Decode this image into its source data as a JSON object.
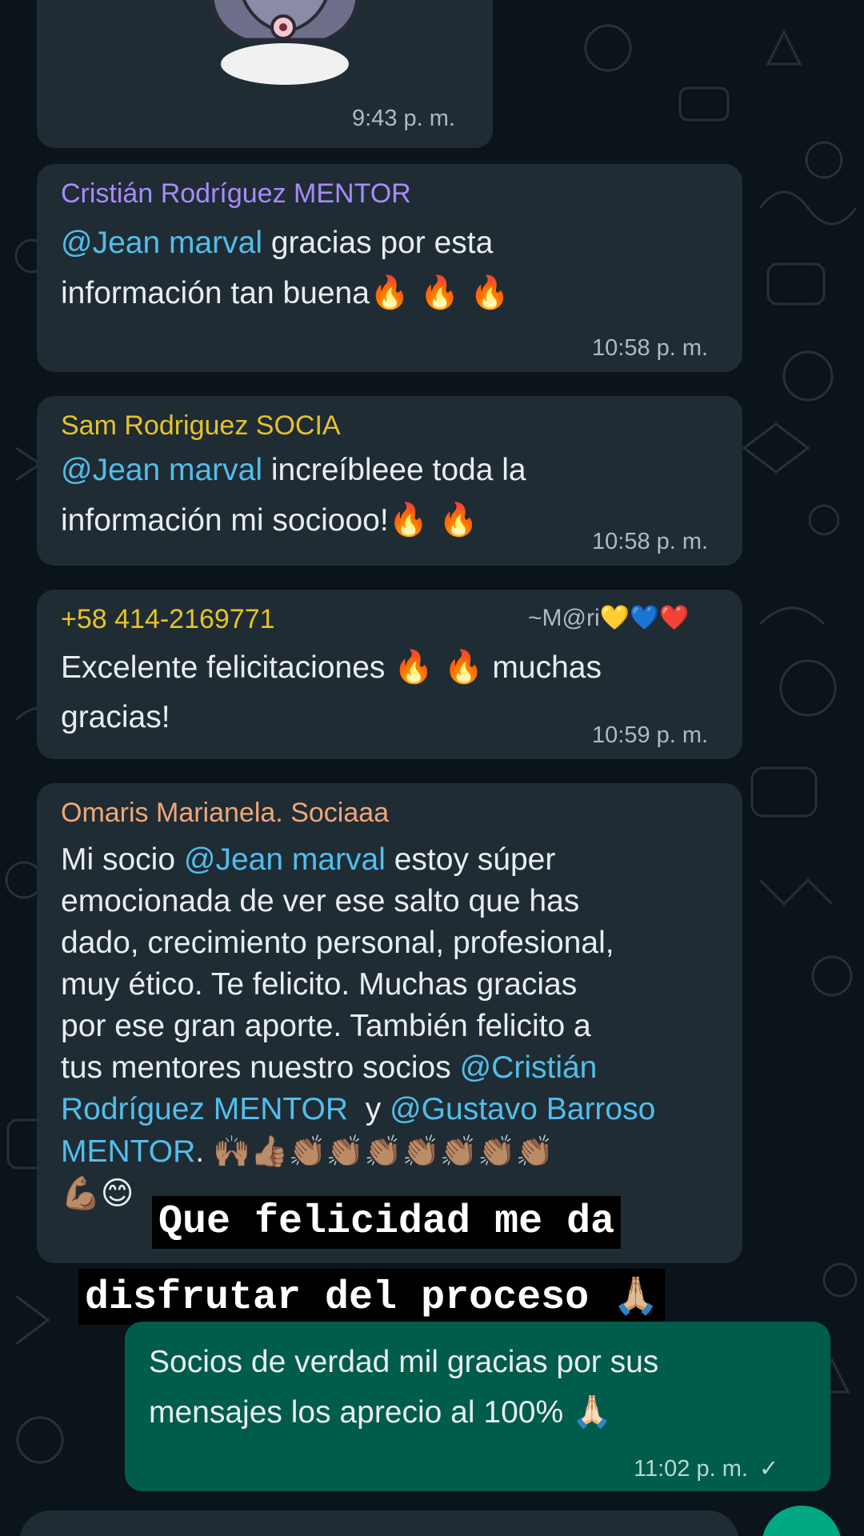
{
  "messages": [
    {
      "time": "9:43 p. m."
    },
    {
      "sender": "Cristián Rodríguez MENTOR",
      "sender_color": "#a78bfa",
      "mention": "@Jean marval",
      "line1_rest": " gracias por esta",
      "line2": "información tan buena",
      "emojis": "🔥 🔥 🔥",
      "time": "10:58 p. m."
    },
    {
      "sender": "Sam Rodriguez SOCIA",
      "sender_color": "#e6c229",
      "mention": "@Jean marval",
      "line1_rest": " increíbleee toda la",
      "line2": "información mi sociooo!",
      "emojis": "🔥 🔥",
      "time": "10:58 p. m."
    },
    {
      "sender": "+58 414-2169771",
      "sender_color": "#e6c229",
      "pushname": "~M@ri",
      "pushname_emojis": "💛💙❤️",
      "line1": "Excelente felicitaciones",
      "line1_emojis": "🔥 🔥",
      "line1_rest": "muchas",
      "line2": "gracias!",
      "time": "10:59 p. m."
    },
    {
      "sender": "Omaris Marianela. Sociaaa",
      "sender_color": "#f0a679",
      "line1_pre": "Mi socio ",
      "line1_mention": "@Jean marval",
      "line1_post": " estoy súper",
      "line2": "emocionada  de ver ese salto que has",
      "line3": "dado, crecimiento  personal, profesional,",
      "line4": "muy ético. Te felicito. Muchas gracias",
      "line5": "por ese gran aporte. También felicito a",
      "line6_pre": "tus mentores nuestro socios ",
      "line6_mention": "@Cristián",
      "line7_mention": "Rodríguez MENTOR",
      "line7_mid": "  y ",
      "line7_mention2": "@Gustavo Barroso",
      "line8_mention": "MENTOR",
      "line8_post": ".",
      "line8_emojis": "🙌🏽👍🏽👏🏽👏🏽👏🏽👏🏽👏🏽👏🏽👏🏽",
      "line9_emojis": "💪🏽😊"
    },
    {
      "outgoing": true,
      "line1": "Socios de verdad mil gracias por sus",
      "line2": "mensajes los aprecio al 100%",
      "line2_emoji": "🙏🏻",
      "time": "11:02 p. m.",
      "status_icon": "check-icon",
      "status_glyph": "✓"
    }
  ],
  "overlay_caption": {
    "line1": "Que felicidad me da",
    "line2": "disfrutar del proceso",
    "line2_emoji": "🙏🏼"
  },
  "colors": {
    "background": "#0b141a",
    "incoming_bubble": "#1f2c34",
    "outgoing_bubble": "#005c4b",
    "mention": "#53bdeb",
    "accent": "#00a884"
  }
}
